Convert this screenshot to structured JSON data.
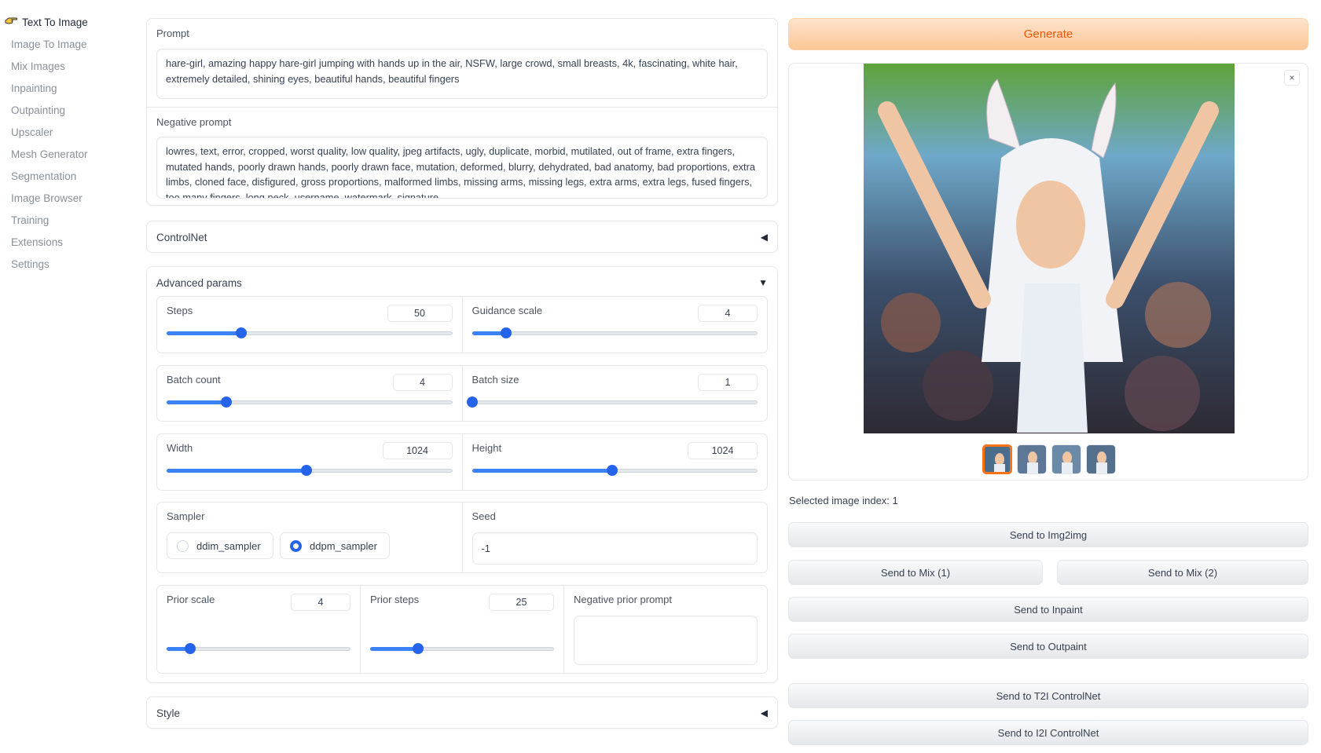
{
  "sidebar": {
    "items": [
      {
        "label": "Text To Image",
        "active": true
      },
      {
        "label": "Image To Image"
      },
      {
        "label": "Mix Images"
      },
      {
        "label": "Inpainting"
      },
      {
        "label": "Outpainting"
      },
      {
        "label": "Upscaler"
      },
      {
        "label": "Mesh Generator"
      },
      {
        "label": "Segmentation"
      },
      {
        "label": "Image Browser"
      },
      {
        "label": "Training"
      },
      {
        "label": "Extensions"
      },
      {
        "label": "Settings"
      }
    ]
  },
  "prompt": {
    "label": "Prompt",
    "value": "hare-girl, amazing happy hare-girl jumping with hands up in the air, NSFW, large crowd, small breasts, 4k, fascinating, white hair, extremely detailed, shining eyes, beautiful hands, beautiful fingers"
  },
  "negative_prompt": {
    "label": "Negative prompt",
    "value": "lowres, text, error, cropped, worst quality, low quality, jpeg artifacts, ugly, duplicate, morbid, mutilated, out of frame, extra fingers, mutated hands, poorly drawn hands, poorly drawn face, mutation, deformed, blurry, dehydrated, bad anatomy, bad proportions, extra limbs, cloned face, disfigured, gross proportions, malformed limbs, missing arms, missing legs, extra arms, extra legs, fused fingers, too many fingers, long neck, username, watermark, signature"
  },
  "controlnet": {
    "title": "ControlNet",
    "arrow": "◀"
  },
  "advanced": {
    "title": "Advanced params",
    "arrow": "▼",
    "steps": {
      "label": "Steps",
      "value": "50",
      "fraction": 0.26
    },
    "guidance": {
      "label": "Guidance scale",
      "value": "4",
      "fraction": 0.12
    },
    "batch_count": {
      "label": "Batch count",
      "value": "4",
      "fraction": 0.21
    },
    "batch_size": {
      "label": "Batch size",
      "value": "1",
      "fraction": 0.0
    },
    "width": {
      "label": "Width",
      "value": "1024",
      "fraction": 0.49
    },
    "height": {
      "label": "Height",
      "value": "1024",
      "fraction": 0.49
    },
    "sampler": {
      "label": "Sampler",
      "options": [
        "ddim_sampler",
        "ddpm_sampler"
      ],
      "selected": "ddpm_sampler"
    },
    "seed": {
      "label": "Seed",
      "value": "-1"
    },
    "prior_scale": {
      "label": "Prior scale",
      "value": "4",
      "fraction": 0.13
    },
    "prior_steps": {
      "label": "Prior steps",
      "value": "25",
      "fraction": 0.26
    },
    "negative_prior_prompt": {
      "label": "Negative prior prompt",
      "value": ""
    }
  },
  "style": {
    "title": "Style",
    "arrow": "◀"
  },
  "generate_label": "Generate",
  "gallery": {
    "close": "×",
    "thumbnail_count": 4,
    "selected": 1
  },
  "selected_index_text": "Selected image index: 1",
  "actions": {
    "img2img": "Send to Img2img",
    "mix1": "Send to Mix (1)",
    "mix2": "Send to Mix (2)",
    "inpaint": "Send to Inpaint",
    "outpaint": "Send to Outpaint",
    "t2i_controlnet": "Send to T2I ControlNet",
    "i2i_controlnet": "Send to I2I ControlNet"
  },
  "colors": {
    "accent": "#2563eb",
    "generate_text": "#ea580c",
    "selected_thumb": "#f97316"
  }
}
